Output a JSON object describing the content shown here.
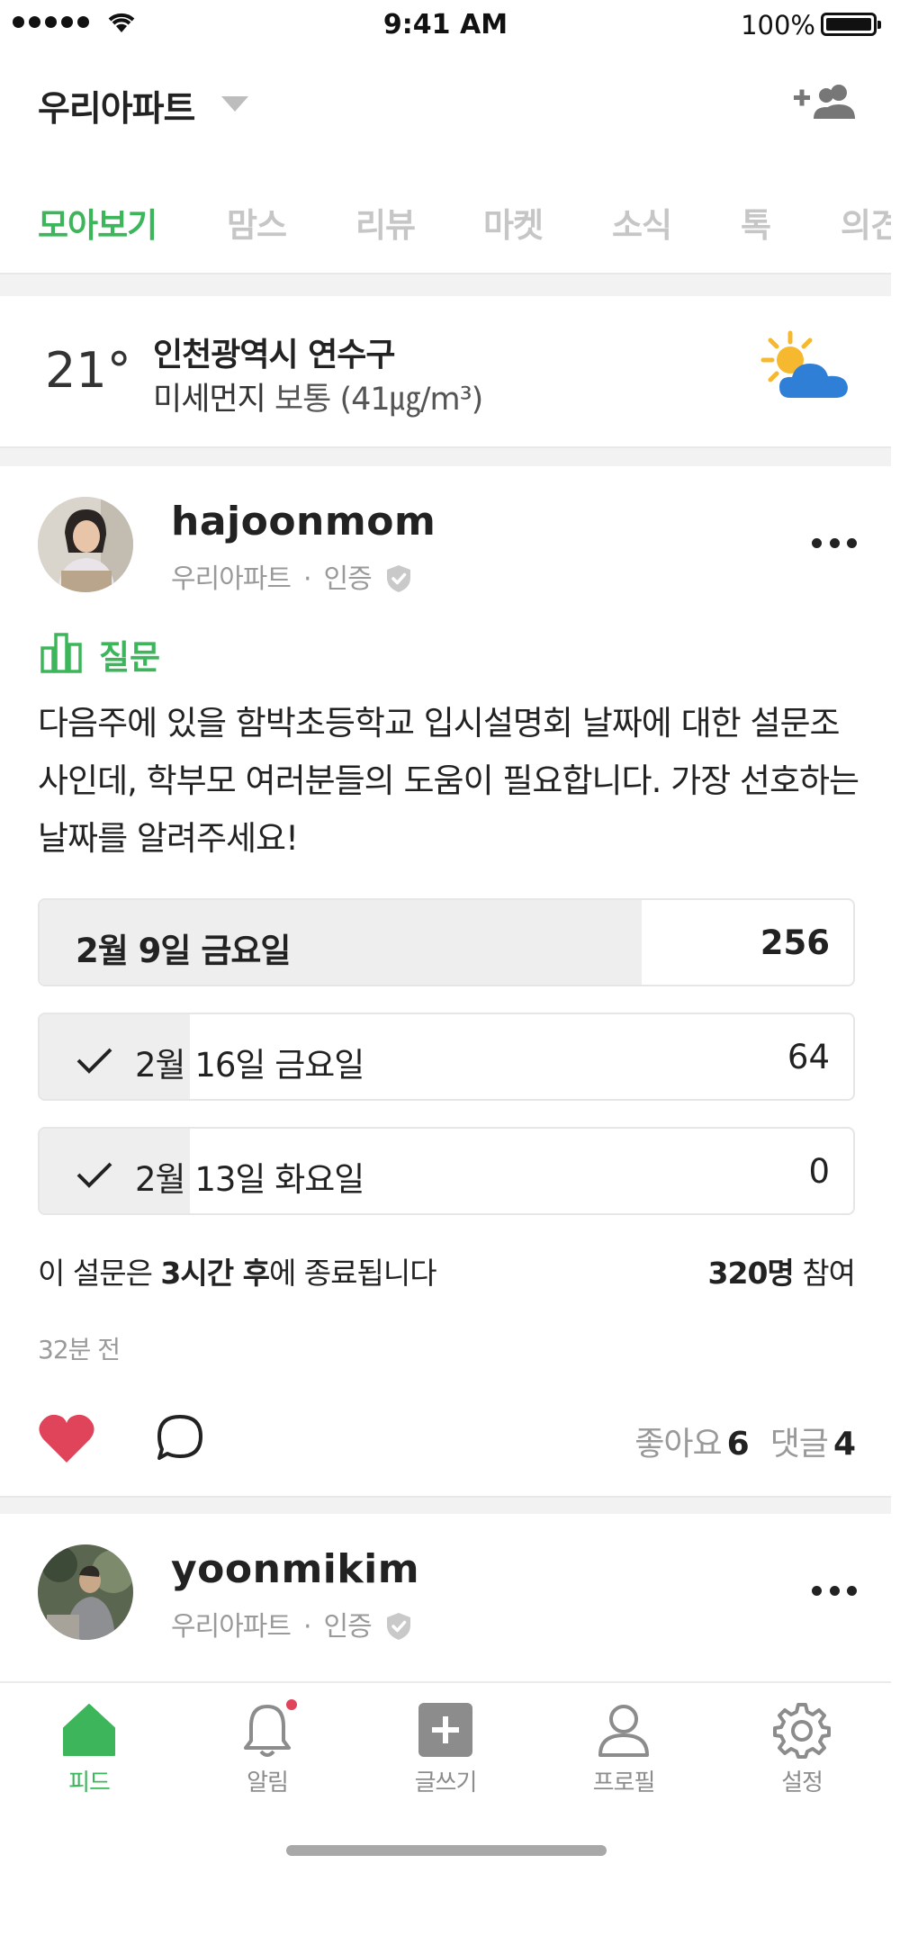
{
  "status_bar": {
    "time": "9:41 AM",
    "battery": "100%"
  },
  "header": {
    "apartment": "우리아파트"
  },
  "tabs": [
    {
      "label": "모아보기",
      "active": true
    },
    {
      "label": "맘스"
    },
    {
      "label": "리뷰"
    },
    {
      "label": "마켓"
    },
    {
      "label": "소식"
    },
    {
      "label": "톡"
    },
    {
      "label": "의견"
    }
  ],
  "weather": {
    "temperature": "21°",
    "location": "인천광역시 연수구",
    "dust_label": "미세먼지",
    "dust_level": "보통",
    "dust_value": "(41㎍/m³)"
  },
  "posts": [
    {
      "username": "hajoonmom",
      "apartment": "우리아파트",
      "verified": "인증",
      "category": "질문",
      "body": "다음주에 있을 함박초등학교 입시설명회 날짜에 대한 설문조사인데, 학부모 여러분들의 도움이 필요합니다. 가장 선호하는 날짜를 알려주세요!",
      "poll": {
        "options": [
          {
            "label": "2월 9일 금요일",
            "count": "256",
            "share": 0.74,
            "checked": false
          },
          {
            "label": "2월 16일 금요일",
            "count": "64",
            "share": 0.185,
            "checked": true
          },
          {
            "label": "2월 13일 화요일",
            "count": "0",
            "share": 0.185,
            "checked": true
          }
        ],
        "ends_prefix": "이 설문은 ",
        "ends_bold": "3시간 후",
        "ends_suffix": "에 종료됩니다",
        "participants_bold": "320명",
        "participants_suffix": " 참여"
      },
      "time_ago": "32분 전",
      "likes_label": "좋아요",
      "likes": "6",
      "comments_label": "댓글",
      "comments": "4"
    },
    {
      "username": "yoonmikim",
      "apartment": "우리아파트",
      "verified": "인증"
    }
  ],
  "bottom_nav": [
    {
      "label": "피드",
      "icon": "home-icon",
      "active": true
    },
    {
      "label": "알림",
      "icon": "bell-icon",
      "has_badge": true
    },
    {
      "label": "글쓰기",
      "icon": "write-plus-icon"
    },
    {
      "label": "프로필",
      "icon": "profile-icon"
    },
    {
      "label": "설정",
      "icon": "gear-icon"
    }
  ],
  "colors": {
    "accent": "#3cb55b",
    "heart": "#e0445a",
    "muted": "#9a9a9a"
  }
}
